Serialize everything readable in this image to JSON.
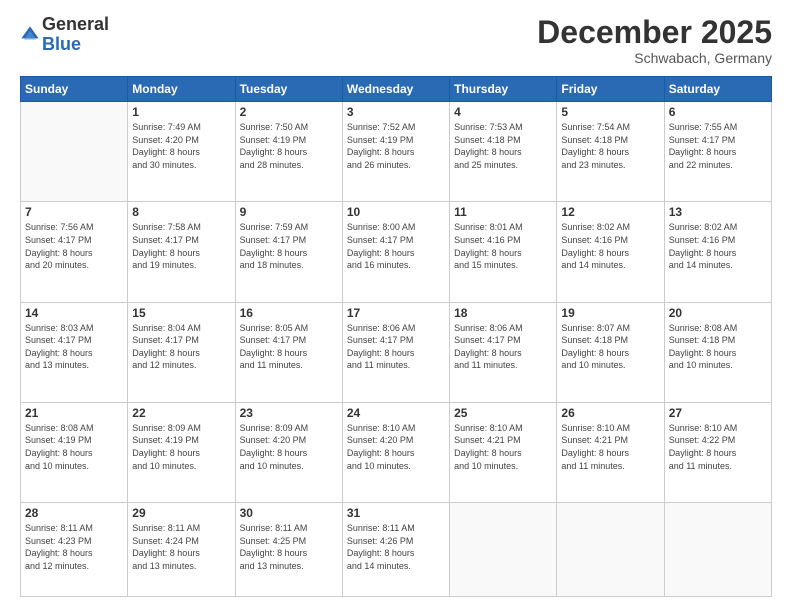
{
  "logo": {
    "general": "General",
    "blue": "Blue"
  },
  "header": {
    "month": "December 2025",
    "location": "Schwabach, Germany"
  },
  "weekdays": [
    "Sunday",
    "Monday",
    "Tuesday",
    "Wednesday",
    "Thursday",
    "Friday",
    "Saturday"
  ],
  "weeks": [
    [
      {
        "day": "",
        "info": ""
      },
      {
        "day": "1",
        "info": "Sunrise: 7:49 AM\nSunset: 4:20 PM\nDaylight: 8 hours\nand 30 minutes."
      },
      {
        "day": "2",
        "info": "Sunrise: 7:50 AM\nSunset: 4:19 PM\nDaylight: 8 hours\nand 28 minutes."
      },
      {
        "day": "3",
        "info": "Sunrise: 7:52 AM\nSunset: 4:19 PM\nDaylight: 8 hours\nand 26 minutes."
      },
      {
        "day": "4",
        "info": "Sunrise: 7:53 AM\nSunset: 4:18 PM\nDaylight: 8 hours\nand 25 minutes."
      },
      {
        "day": "5",
        "info": "Sunrise: 7:54 AM\nSunset: 4:18 PM\nDaylight: 8 hours\nand 23 minutes."
      },
      {
        "day": "6",
        "info": "Sunrise: 7:55 AM\nSunset: 4:17 PM\nDaylight: 8 hours\nand 22 minutes."
      }
    ],
    [
      {
        "day": "7",
        "info": "Sunrise: 7:56 AM\nSunset: 4:17 PM\nDaylight: 8 hours\nand 20 minutes."
      },
      {
        "day": "8",
        "info": "Sunrise: 7:58 AM\nSunset: 4:17 PM\nDaylight: 8 hours\nand 19 minutes."
      },
      {
        "day": "9",
        "info": "Sunrise: 7:59 AM\nSunset: 4:17 PM\nDaylight: 8 hours\nand 18 minutes."
      },
      {
        "day": "10",
        "info": "Sunrise: 8:00 AM\nSunset: 4:17 PM\nDaylight: 8 hours\nand 16 minutes."
      },
      {
        "day": "11",
        "info": "Sunrise: 8:01 AM\nSunset: 4:16 PM\nDaylight: 8 hours\nand 15 minutes."
      },
      {
        "day": "12",
        "info": "Sunrise: 8:02 AM\nSunset: 4:16 PM\nDaylight: 8 hours\nand 14 minutes."
      },
      {
        "day": "13",
        "info": "Sunrise: 8:02 AM\nSunset: 4:16 PM\nDaylight: 8 hours\nand 14 minutes."
      }
    ],
    [
      {
        "day": "14",
        "info": "Sunrise: 8:03 AM\nSunset: 4:17 PM\nDaylight: 8 hours\nand 13 minutes."
      },
      {
        "day": "15",
        "info": "Sunrise: 8:04 AM\nSunset: 4:17 PM\nDaylight: 8 hours\nand 12 minutes."
      },
      {
        "day": "16",
        "info": "Sunrise: 8:05 AM\nSunset: 4:17 PM\nDaylight: 8 hours\nand 11 minutes."
      },
      {
        "day": "17",
        "info": "Sunrise: 8:06 AM\nSunset: 4:17 PM\nDaylight: 8 hours\nand 11 minutes."
      },
      {
        "day": "18",
        "info": "Sunrise: 8:06 AM\nSunset: 4:17 PM\nDaylight: 8 hours\nand 11 minutes."
      },
      {
        "day": "19",
        "info": "Sunrise: 8:07 AM\nSunset: 4:18 PM\nDaylight: 8 hours\nand 10 minutes."
      },
      {
        "day": "20",
        "info": "Sunrise: 8:08 AM\nSunset: 4:18 PM\nDaylight: 8 hours\nand 10 minutes."
      }
    ],
    [
      {
        "day": "21",
        "info": "Sunrise: 8:08 AM\nSunset: 4:19 PM\nDaylight: 8 hours\nand 10 minutes."
      },
      {
        "day": "22",
        "info": "Sunrise: 8:09 AM\nSunset: 4:19 PM\nDaylight: 8 hours\nand 10 minutes."
      },
      {
        "day": "23",
        "info": "Sunrise: 8:09 AM\nSunset: 4:20 PM\nDaylight: 8 hours\nand 10 minutes."
      },
      {
        "day": "24",
        "info": "Sunrise: 8:10 AM\nSunset: 4:20 PM\nDaylight: 8 hours\nand 10 minutes."
      },
      {
        "day": "25",
        "info": "Sunrise: 8:10 AM\nSunset: 4:21 PM\nDaylight: 8 hours\nand 10 minutes."
      },
      {
        "day": "26",
        "info": "Sunrise: 8:10 AM\nSunset: 4:21 PM\nDaylight: 8 hours\nand 11 minutes."
      },
      {
        "day": "27",
        "info": "Sunrise: 8:10 AM\nSunset: 4:22 PM\nDaylight: 8 hours\nand 11 minutes."
      }
    ],
    [
      {
        "day": "28",
        "info": "Sunrise: 8:11 AM\nSunset: 4:23 PM\nDaylight: 8 hours\nand 12 minutes."
      },
      {
        "day": "29",
        "info": "Sunrise: 8:11 AM\nSunset: 4:24 PM\nDaylight: 8 hours\nand 13 minutes."
      },
      {
        "day": "30",
        "info": "Sunrise: 8:11 AM\nSunset: 4:25 PM\nDaylight: 8 hours\nand 13 minutes."
      },
      {
        "day": "31",
        "info": "Sunrise: 8:11 AM\nSunset: 4:26 PM\nDaylight: 8 hours\nand 14 minutes."
      },
      {
        "day": "",
        "info": ""
      },
      {
        "day": "",
        "info": ""
      },
      {
        "day": "",
        "info": ""
      }
    ]
  ]
}
